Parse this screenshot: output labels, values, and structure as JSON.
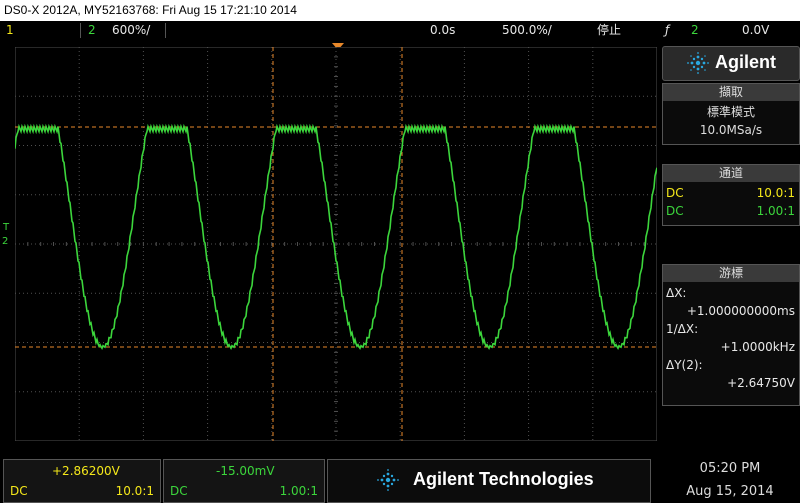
{
  "title_bar": {
    "text": "DS0-X 2012A, MY52163768: Fri Aug 15 17:21:10 2014"
  },
  "top_bar": {
    "ch1_label": "1",
    "ch2_label": "2",
    "ch2_scale": "600%/",
    "time_delay": "0.0s",
    "time_scale": "500.0%/",
    "run_state": "停止",
    "trigger_symbol": "ƒ",
    "trigger_source": "2",
    "trigger_level": "0.0V"
  },
  "logo": {
    "text": "Agilent"
  },
  "acquire": {
    "header": "擷取",
    "mode": "標準模式",
    "rate": "10.0MSa/s"
  },
  "channels": {
    "header": "通道",
    "ch1": {
      "coupling": "DC",
      "probe": "10.0:1"
    },
    "ch2": {
      "coupling": "DC",
      "probe": "1.00:1"
    }
  },
  "cursors": {
    "header": "游標",
    "dx_label": "ΔX:",
    "dx_value": "+1.000000000ms",
    "inv_dx_label": "1/ΔX:",
    "inv_dx_value": "+1.0000kHz",
    "dy_label": "ΔY(2):",
    "dy_value": "+2.64750V"
  },
  "bottom": {
    "ch1": {
      "offset": "+2.86200V",
      "coupling": "DC",
      "probe": "10.0:1"
    },
    "ch2": {
      "offset": "-15.00mV",
      "coupling": "DC",
      "probe": "1.00:1"
    },
    "brand": "Agilent Technologies",
    "time": "05:20 PM",
    "date": "Aug 15, 2014"
  },
  "markers": {
    "trigger": "T",
    "ch2": "2"
  },
  "colors": {
    "ch1": "#f5e81a",
    "ch2": "#3cd63c",
    "cursor": "#e8882a",
    "grid": "#505050"
  }
}
